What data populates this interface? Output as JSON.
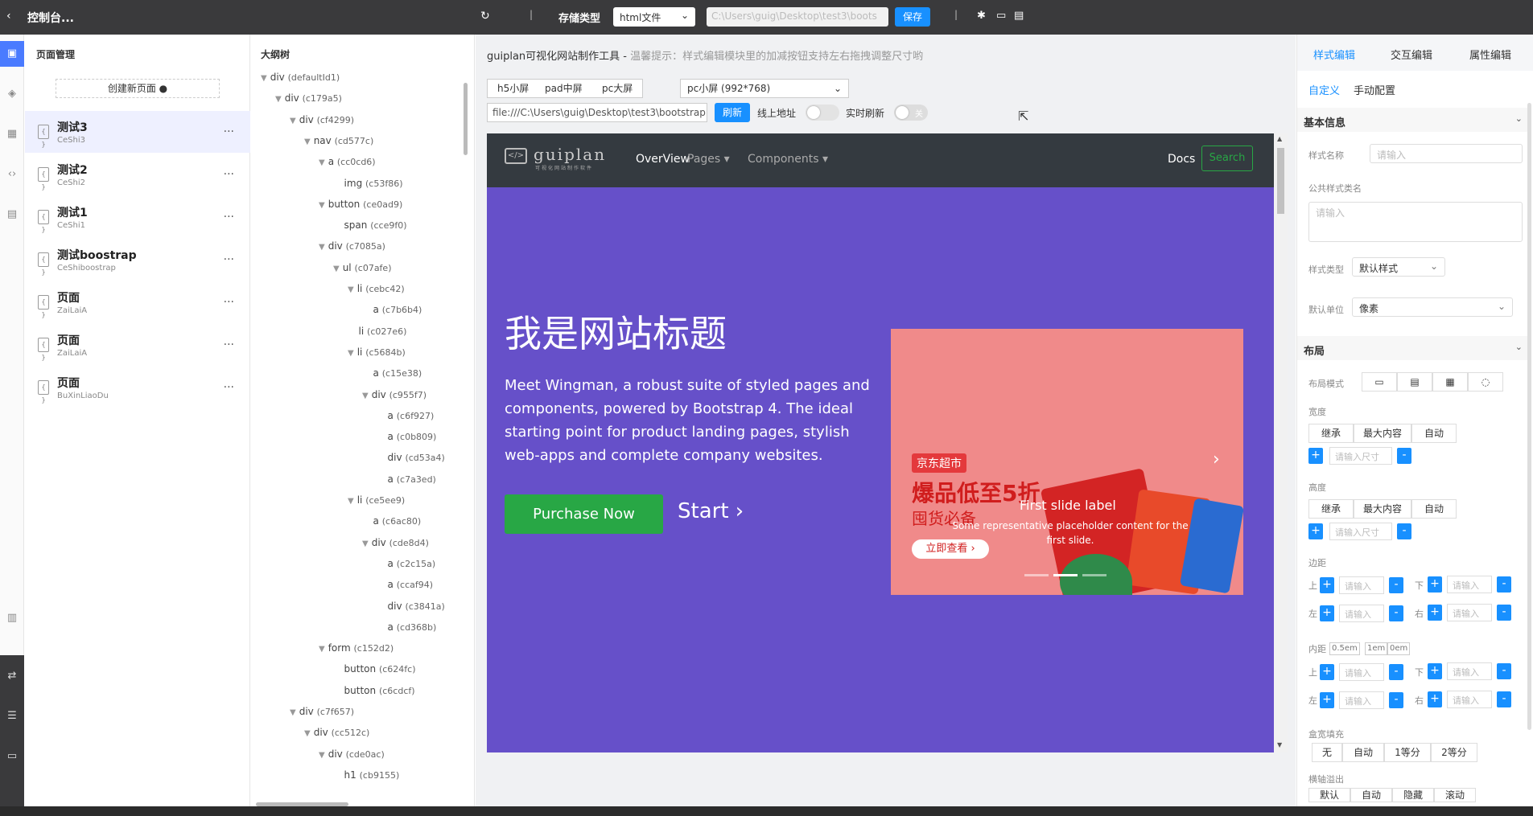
{
  "topbar": {
    "back": "‹",
    "title": "控制台...",
    "storage_label": "存储类型",
    "storage_value": "html文件",
    "path": "C:\\Users\\guig\\Desktop\\test3\\boots",
    "save": "保存"
  },
  "pages": {
    "header": "页面管理",
    "create": "创建新页面",
    "items": [
      {
        "name": "测试3",
        "sub": "CeShi3"
      },
      {
        "name": "测试2",
        "sub": "CeShi2"
      },
      {
        "name": "测试1",
        "sub": "CeShi1"
      },
      {
        "name": "测试boostrap",
        "sub": "CeShiboostrap"
      },
      {
        "name": "页面",
        "sub": "ZaiLaiA"
      },
      {
        "name": "页面",
        "sub": "ZaiLaiA"
      },
      {
        "name": "页面",
        "sub": "BuXinLiaoDu"
      }
    ],
    "more": "..."
  },
  "tree": {
    "header": "大纲树",
    "nodes": [
      {
        "tag": "div",
        "id": "(defaultId1)",
        "depth": 0,
        "open": true
      },
      {
        "tag": "div",
        "id": "(c179a5)",
        "depth": 1,
        "open": true
      },
      {
        "tag": "div",
        "id": "(cf4299)",
        "depth": 2,
        "open": true
      },
      {
        "tag": "nav",
        "id": "(cd577c)",
        "depth": 3,
        "open": true
      },
      {
        "tag": "a",
        "id": "(cc0cd6)",
        "depth": 4,
        "open": true
      },
      {
        "tag": "img",
        "id": "(c53f86)",
        "depth": 5,
        "open": false
      },
      {
        "tag": "button",
        "id": "(ce0ad9)",
        "depth": 4,
        "open": true
      },
      {
        "tag": "span",
        "id": "(cce9f0)",
        "depth": 5,
        "open": false
      },
      {
        "tag": "div",
        "id": "(c7085a)",
        "depth": 4,
        "open": true
      },
      {
        "tag": "ul",
        "id": "(c07afe)",
        "depth": 5,
        "open": true
      },
      {
        "tag": "li",
        "id": "(cebc42)",
        "depth": 6,
        "open": true
      },
      {
        "tag": "a",
        "id": "(c7b6b4)",
        "depth": 7,
        "open": false
      },
      {
        "tag": "li",
        "id": "(c027e6)",
        "depth": 6,
        "open": false
      },
      {
        "tag": "li",
        "id": "(c5684b)",
        "depth": 6,
        "open": true
      },
      {
        "tag": "a",
        "id": "(c15e38)",
        "depth": 7,
        "open": false
      },
      {
        "tag": "div",
        "id": "(c955f7)",
        "depth": 7,
        "open": true
      },
      {
        "tag": "a",
        "id": "(c6f927)",
        "depth": 8,
        "open": false
      },
      {
        "tag": "a",
        "id": "(c0b809)",
        "depth": 8,
        "open": false
      },
      {
        "tag": "div",
        "id": "(cd53a4)",
        "depth": 8,
        "open": false
      },
      {
        "tag": "a",
        "id": "(c7a3ed)",
        "depth": 8,
        "open": false
      },
      {
        "tag": "li",
        "id": "(ce5ee9)",
        "depth": 6,
        "open": true
      },
      {
        "tag": "a",
        "id": "(c6ac80)",
        "depth": 7,
        "open": false
      },
      {
        "tag": "div",
        "id": "(cde8d4)",
        "depth": 7,
        "open": true
      },
      {
        "tag": "a",
        "id": "(c2c15a)",
        "depth": 8,
        "open": false
      },
      {
        "tag": "a",
        "id": "(ccaf94)",
        "depth": 8,
        "open": false
      },
      {
        "tag": "div",
        "id": "(c3841a)",
        "depth": 8,
        "open": false
      },
      {
        "tag": "a",
        "id": "(cd368b)",
        "depth": 8,
        "open": false
      },
      {
        "tag": "form",
        "id": "(c152d2)",
        "depth": 4,
        "open": true
      },
      {
        "tag": "button",
        "id": "(c624fc)",
        "depth": 5,
        "open": false
      },
      {
        "tag": "button",
        "id": "(c6cdcf)",
        "depth": 5,
        "open": false
      },
      {
        "tag": "div",
        "id": "(c7f657)",
        "depth": 2,
        "open": true
      },
      {
        "tag": "div",
        "id": "(cc512c)",
        "depth": 3,
        "open": true
      },
      {
        "tag": "div",
        "id": "(cde0ac)",
        "depth": 4,
        "open": true
      },
      {
        "tag": "h1",
        "id": "(cb9155)",
        "depth": 5,
        "open": false
      }
    ]
  },
  "center": {
    "hint_title": "guiplan可视化网站制作工具 - ",
    "hint_warn": "温馨提示：样式编辑模块里的加减按钮支持左右拖拽调整尺寸哟",
    "screens": [
      "h5小屏",
      "pad中屏",
      "pc大屏"
    ],
    "screen_select": "pc小屏 (992*768)",
    "url": "file:///C:\\Users\\guig\\Desktop\\test3\\bootstrap",
    "refresh": "刷新",
    "online_label": "线上地址",
    "live_label": "实时刷新",
    "live_off": "关"
  },
  "preview": {
    "logo_word": "guiplan",
    "logo_tag": "可视化网站制作软件",
    "nav": [
      "OverView",
      "Pages ▾",
      "Components ▾"
    ],
    "docs": "Docs",
    "search": "Search",
    "title": "我是网站标题",
    "lead": "Meet Wingman, a robust suite of styled pages and components, powered by Bootstrap 4. The ideal starting point for product landing pages, stylish web-apps and complete company websites.",
    "buy": "Purchase Now",
    "start": "Start ›",
    "carousel": {
      "badge": "京东超市",
      "promo": "爆品低至5折",
      "promo2": "囤货必备",
      "shop": "立即查看 ›",
      "caption_title": "First slide label",
      "caption_text": "Some representative placeholder content for the first slide."
    }
  },
  "right": {
    "tabs": [
      "样式编辑",
      "交互编辑",
      "属性编辑"
    ],
    "subtabs": [
      "自定义",
      "手动配置"
    ],
    "basic": {
      "title": "基本信息",
      "style_name_label": "样式名称",
      "placeholder": "请输入",
      "public_class_label": "公共样式类名",
      "style_type_label": "样式类型",
      "style_type": "默认样式",
      "unit_label": "默认单位",
      "unit": "像素"
    },
    "layout": {
      "title": "布局",
      "mode_label": "布局模式",
      "width_label": "宽度",
      "height_label": "高度",
      "size_options": [
        "继承",
        "最大内容",
        "自动"
      ],
      "size_placeholder": "请输入尺寸",
      "margin_label": "边距",
      "padding_label": "内距",
      "padding_chips": [
        "0.5em",
        "1em",
        "0em"
      ],
      "top": "上",
      "bottom": "下",
      "left": "左",
      "right": "右",
      "fill_label": "盒宽填充",
      "fill_options": [
        "无",
        "自动",
        "1等分",
        "2等分"
      ],
      "overflow_label": "横轴溢出",
      "overflow_options": [
        "默认",
        "自动",
        "隐藏",
        "滚动"
      ]
    }
  }
}
